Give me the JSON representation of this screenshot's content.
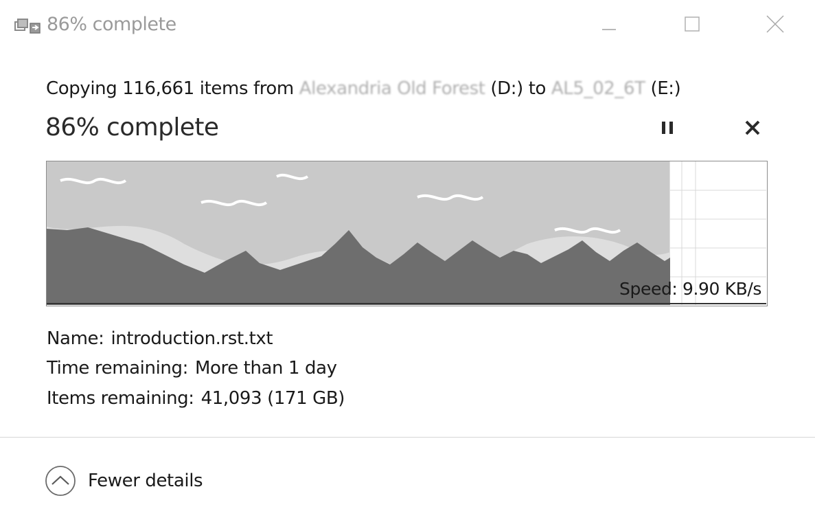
{
  "window": {
    "title": "86% complete",
    "controls": {
      "minimize_icon": "minimize-icon",
      "maximize_icon": "maximize-icon",
      "close_icon": "close-icon"
    }
  },
  "copy": {
    "prefix": "Copying 116,661 items from ",
    "source_name": "Alexandria Old Forest",
    "source_drive": " (D:) to ",
    "dest_name": "AL5_02_6T",
    "dest_drive": " (E:)"
  },
  "progress": {
    "title": "86% complete",
    "percent": 86,
    "pause_icon": "pause-icon",
    "cancel_icon": "cancel-icon"
  },
  "graph": {
    "speed_label": "Speed: 9.90 KB/s",
    "fill_color": "#6e6e6e",
    "sky_color": "#c8c8c8"
  },
  "details": {
    "name_label": "Name:",
    "name_value": "introduction.rst.txt",
    "time_label": "Time remaining:",
    "time_value": "More than 1 day",
    "items_label": "Items remaining:",
    "items_value": "41,093 (171 GB)"
  },
  "footer": {
    "fewer_details_label": "Fewer details",
    "fewer_details_icon": "chevron-up-icon"
  }
}
